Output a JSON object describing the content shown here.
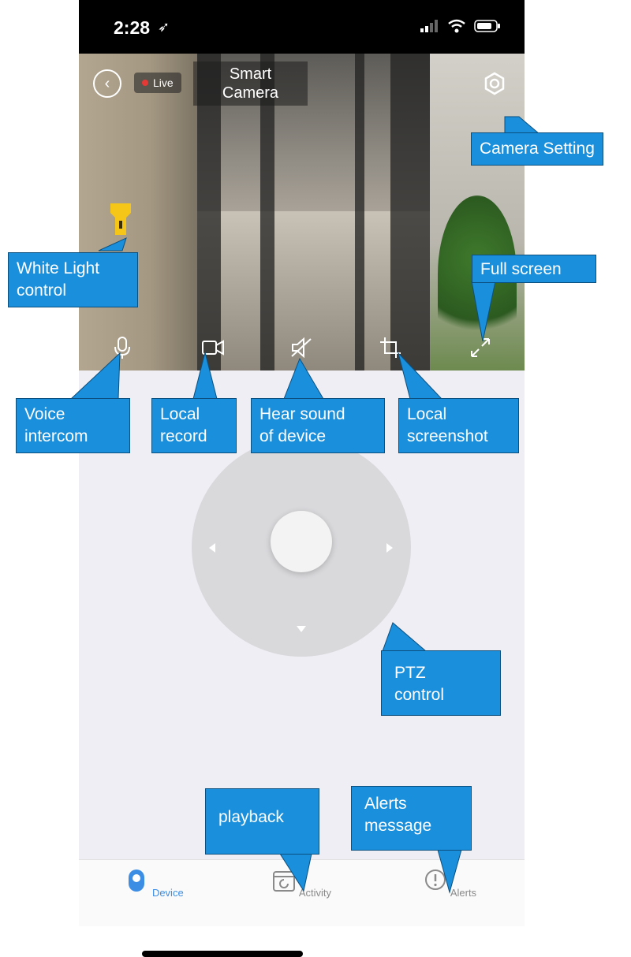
{
  "status_bar": {
    "time": "2:28"
  },
  "header": {
    "live_label": "Live",
    "title_line1": "Smart",
    "title_line2": "Camera"
  },
  "tabs": [
    {
      "label": "Device",
      "icon": "device-icon",
      "active": true
    },
    {
      "label": "Activity",
      "icon": "activity-icon",
      "active": false
    },
    {
      "label": "Alerts",
      "icon": "alerts-icon",
      "active": false
    }
  ],
  "callouts": {
    "camera_setting": "Camera Setting",
    "white_light_line1": "White  Light",
    "white_light_line2": "control",
    "full_screen": "Full screen",
    "voice_line1": "Voice",
    "voice_line2": "intercom",
    "record_line1": "Local",
    "record_line2": "record",
    "hear_line1": "Hear  sound",
    "hear_line2": "of device",
    "screenshot_line1": "Local",
    "screenshot_line2": "screenshot",
    "ptz_line1": "PTZ",
    "ptz_line2": "control",
    "playback": "playback",
    "alerts_line1": "Alerts",
    "alerts_line2": "message"
  },
  "colors": {
    "accent": "#3c8de4",
    "callout": "#1a8fdb",
    "live_dot": "#e53935",
    "light_icon": "#f5c518"
  }
}
